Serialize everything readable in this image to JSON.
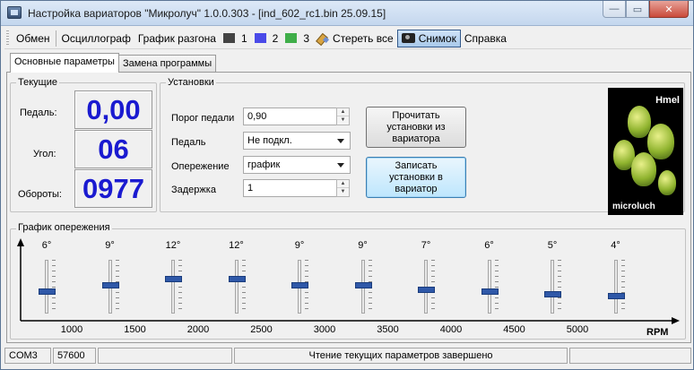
{
  "window": {
    "title": "Настройка вариаторов \"Микролуч\" 1.0.0.303 - [ind_602_rc1.bin 25.09.15]",
    "buttons": {
      "minimize": "—",
      "maximize": "▭",
      "close": "✕"
    }
  },
  "toolbar": {
    "exchange": "Обмен",
    "oscilloscope": "Осциллограф",
    "accel_chart": "График разгона",
    "series": [
      {
        "label": "1",
        "color": "#444444"
      },
      {
        "label": "2",
        "color": "#4a4ae8"
      },
      {
        "label": "3",
        "color": "#3fae49"
      }
    ],
    "erase_all": "Стереть все",
    "snapshot": "Снимок",
    "help": "Справка"
  },
  "tabs": {
    "main": "Основные параметры",
    "replace": "Замена программы"
  },
  "current": {
    "title": "Текущие",
    "pedal_label": "Педаль:",
    "pedal_value": "0,00",
    "angle_label": "Угол:",
    "angle_value": "06",
    "rpm_label": "Обороты:",
    "rpm_value": "0977"
  },
  "settings": {
    "title": "Установки",
    "threshold_label": "Порог педали",
    "threshold_value": "0,90",
    "pedal_label": "Педаль",
    "pedal_value": "Не подкл.",
    "advance_label": "Опережение",
    "advance_value": "график",
    "delay_label": "Задержка",
    "delay_value": "1",
    "read_button": "Прочитать установки из вариатора",
    "write_button": "Записать установки в вариатор"
  },
  "logo": {
    "top_text": "Hmel",
    "bottom_text": "microluch"
  },
  "chart": {
    "title": "График опережения",
    "x_label": "RPM",
    "degree_labels": [
      "6°",
      "9°",
      "12°",
      "12°",
      "9°",
      "9°",
      "7°",
      "6°",
      "5°",
      "4°"
    ],
    "slider_values": [
      6,
      9,
      12,
      12,
      9,
      9,
      7,
      6,
      5,
      4
    ],
    "slider_max": 20,
    "rpm_ticks": [
      "1000",
      "1500",
      "2000",
      "2500",
      "3000",
      "3500",
      "4000",
      "4500",
      "5000"
    ]
  },
  "status": {
    "port": "COM3",
    "baud": "57600",
    "message": "Чтение текущих параметров завершено"
  }
}
